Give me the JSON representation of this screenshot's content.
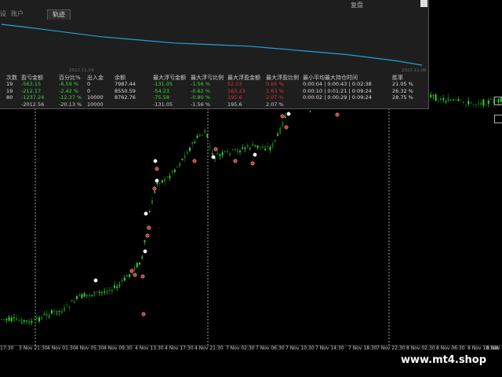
{
  "window": {
    "top_label": "复盘"
  },
  "tabs": [
    {
      "label": "设",
      "active": false
    },
    {
      "label": "账户",
      "active": false
    },
    {
      "label": "轨迹",
      "active": true
    }
  ],
  "equity_chart": {
    "start_date": "2022.11.04",
    "end_date": "2022.11.08",
    "curve": [
      7987,
      7960,
      7930,
      7900,
      7870,
      7850,
      7830,
      7810,
      7800,
      7790,
      7780,
      7760,
      7740,
      7720,
      7700,
      7670,
      7640,
      7600
    ]
  },
  "table": {
    "headers": [
      "次数",
      "盈亏金额",
      "百分比%",
      "出入金",
      "余额",
      "最大浮亏金额",
      "最大浮亏比例",
      "最大浮盈金额",
      "最大浮盈比例",
      "最小平均最大持仓时间",
      "胜率"
    ],
    "rows": [
      {
        "count": "19",
        "pnl": "-563.15",
        "pct": "-6.59 %",
        "io": "0",
        "balance": "7987.44",
        "max_dd": "-131.05",
        "max_dd_pct": "-1.56 %",
        "max_fp": "52.03",
        "max_fp_pct": "0.65 %",
        "hold": "0:00:04 | 0:00:43 | 0:02:38",
        "win": "21.05 %"
      },
      {
        "count": "19",
        "pnl": "-212.17",
        "pct": "-2.42 %",
        "io": "0",
        "balance": "8550.59",
        "max_dd": "-54.23",
        "max_dd_pct": "-0.62 %",
        "max_fp": "163.23",
        "max_fp_pct": "1.63 %",
        "hold": "0:00:10 | 0:01:21 | 0:09:24",
        "win": "26.32 %"
      },
      {
        "count": "80",
        "pnl": "-1237.24",
        "pct": "-12.37 %",
        "io": "10000",
        "balance": "8762.76",
        "max_dd": "-75.58",
        "max_dd_pct": "-0.80 %",
        "max_fp": "195.6",
        "max_fp_pct": "2.07 %",
        "hold": "0:00:02 | 0:00:29 | 0:09:24",
        "win": "28.75 %"
      }
    ],
    "total": {
      "pnl": "-2012.56",
      "pct": "-20.13 %",
      "io": "10000",
      "max_dd": "-131.05",
      "max_dd_pct": "-1.56 %",
      "max_fp": "195.6",
      "max_fp_pct": "2.07 %"
    }
  },
  "x_axis_labels": [
    "17:30",
    "3 Nov 21:30",
    "4 Nov 01:30",
    "4 Nov 05:30",
    "4 Nov 09:30",
    "4 Nov 13:30",
    "4 Nov 17:30",
    "4 Nov 21:30",
    "7 Nov 02:30",
    "7 Nov 06:30",
    "7 Nov 10:30",
    "7 Nov 14:30",
    "7 Nov 18:30",
    "7 Nov 22:30",
    "8 Nov 02:30",
    "8 Nov 06:30",
    "8 Nov 10:30",
    "8 Nov 14:30",
    "8"
  ],
  "watermark": "www.mt4.shop",
  "colors": {
    "bull_candle": "#32d232",
    "bear_candle": "#1a6a1a",
    "equity_line": "#1ea0dc",
    "period_separator": "#c8c8c8",
    "profit": "#3cd43c",
    "loss": "#e03030"
  }
}
